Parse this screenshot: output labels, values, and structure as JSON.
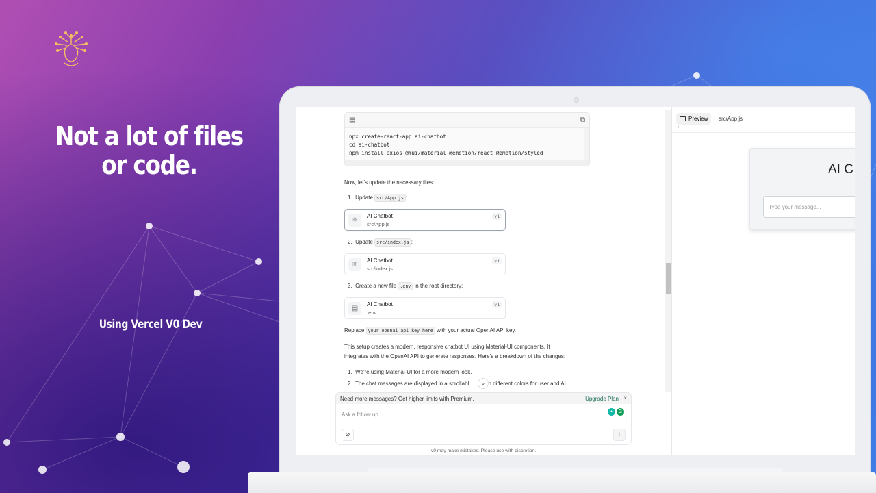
{
  "slide": {
    "headline": "Not a lot of files or code.",
    "subtitle": "Using Vercel V0 Dev"
  },
  "chat": {
    "code_block": {
      "lines": [
        "npx create-react-app ai-chatbot",
        "cd ai-chatbot",
        "npm install axios @mui/material @emotion/react @emotion/styled"
      ]
    },
    "intro": "Now, let's update the necessary files:",
    "steps": [
      {
        "number": "1.",
        "prefix": "Update",
        "code": "src/App.js",
        "suffix": ":"
      },
      {
        "number": "2.",
        "prefix": "Update",
        "code": "src/index.js",
        "suffix": ":"
      },
      {
        "number": "3.",
        "prefix": "Create a new file",
        "code": ".env",
        "suffix": "in the root directory:"
      }
    ],
    "files": [
      {
        "title": "AI Chatbot",
        "path": "src/App.js",
        "version": "v1",
        "icon": "react-icon"
      },
      {
        "title": "AI Chatbot",
        "path": "src/index.js",
        "version": "v1",
        "icon": "react-icon"
      },
      {
        "title": "AI Chatbot",
        "path": ".env",
        "version": "v1",
        "icon": "file-icon"
      }
    ],
    "replace_prefix": "Replace",
    "replace_code": "your_openai_api_key_here",
    "replace_suffix": "with your actual OpenAI API key.",
    "paragraph_line1": "This setup creates a modern, responsive chatbot UI using Material-UI components. It",
    "paragraph_line2": "integrates with the OpenAI API to generate responses. Here's a breakdown of the changes:",
    "list": [
      {
        "number": "1.",
        "text": "We're using Material-UI for a more modern look."
      },
      {
        "number": "2.",
        "text": "The chat messages are displayed in a scrollabl",
        "text_after": "with different colors for user and AI"
      }
    ]
  },
  "upgrade": {
    "message": "Need more messages? Get higher limits with Premium.",
    "link": "Upgrade Plan",
    "close": "×"
  },
  "composer": {
    "placeholder": "Ask a follow up...",
    "disclaimer": "v0 may make mistakes. Please use with discretion."
  },
  "preview": {
    "tabs": [
      "Preview",
      "src/App.js"
    ],
    "app_title": "AI C",
    "input_placeholder": "Type your message..."
  },
  "colors": {
    "accent_link": "#1f6f5c",
    "grammarly": "#0f9d58"
  }
}
